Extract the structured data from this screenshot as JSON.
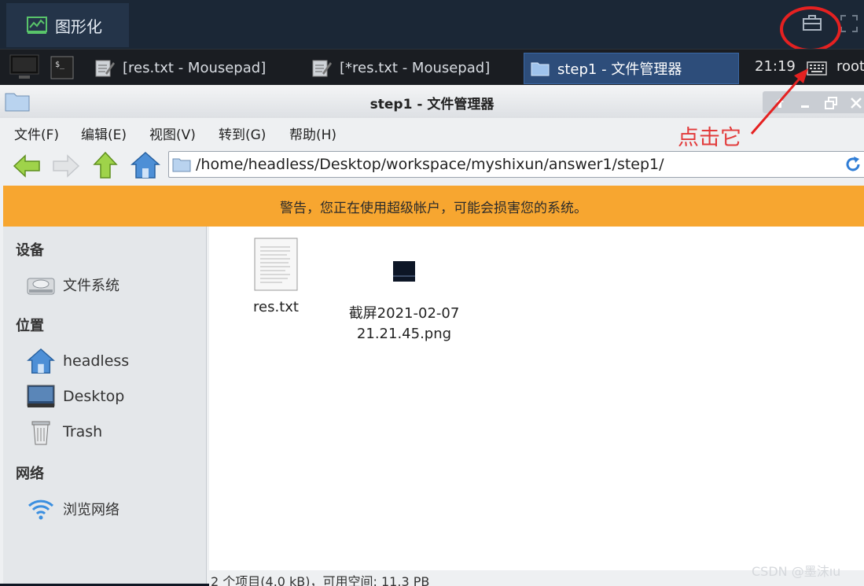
{
  "top_tab": {
    "label": "图形化"
  },
  "taskbar": {
    "tasks": [
      {
        "label": "[res.txt - Mousepad]"
      },
      {
        "label": "[*res.txt - Mousepad]"
      },
      {
        "label": "step1 - 文件管理器"
      }
    ],
    "clock": "21:19",
    "user": "root"
  },
  "window": {
    "title": "step1 - 文件管理器",
    "menu": [
      "文件(F)",
      "编辑(E)",
      "视图(V)",
      "转到(G)",
      "帮助(H)"
    ],
    "path": "/home/headless/Desktop/workspace/myshixun/answer1/step1/",
    "warning": "警告，您正在使用超级帐户，可能会损害您的系统。",
    "sidebar": {
      "devices_header": "设备",
      "devices": [
        {
          "label": "文件系统"
        }
      ],
      "places_header": "位置",
      "places": [
        {
          "label": "headless"
        },
        {
          "label": "Desktop"
        },
        {
          "label": "Trash"
        }
      ],
      "network_header": "网络",
      "network": [
        {
          "label": "浏览网络"
        }
      ]
    },
    "files": [
      {
        "name": "res.txt",
        "icon": "text-file-icon"
      },
      {
        "name_line1": "截屏2021-02-07",
        "name_line2": "21.21.45.png",
        "icon": "image-thumbnail-icon"
      }
    ],
    "status": "2 个项目(4.0 kB)，可用空间: 11.3 PB"
  },
  "annotation": {
    "text": "点击它",
    "color": "#e52121"
  },
  "watermark": "CSDN @墨沫ıu",
  "colors": {
    "warning": "#f7a630",
    "active_task": "#2d4d7a",
    "accent_arrow": "#e52121"
  }
}
